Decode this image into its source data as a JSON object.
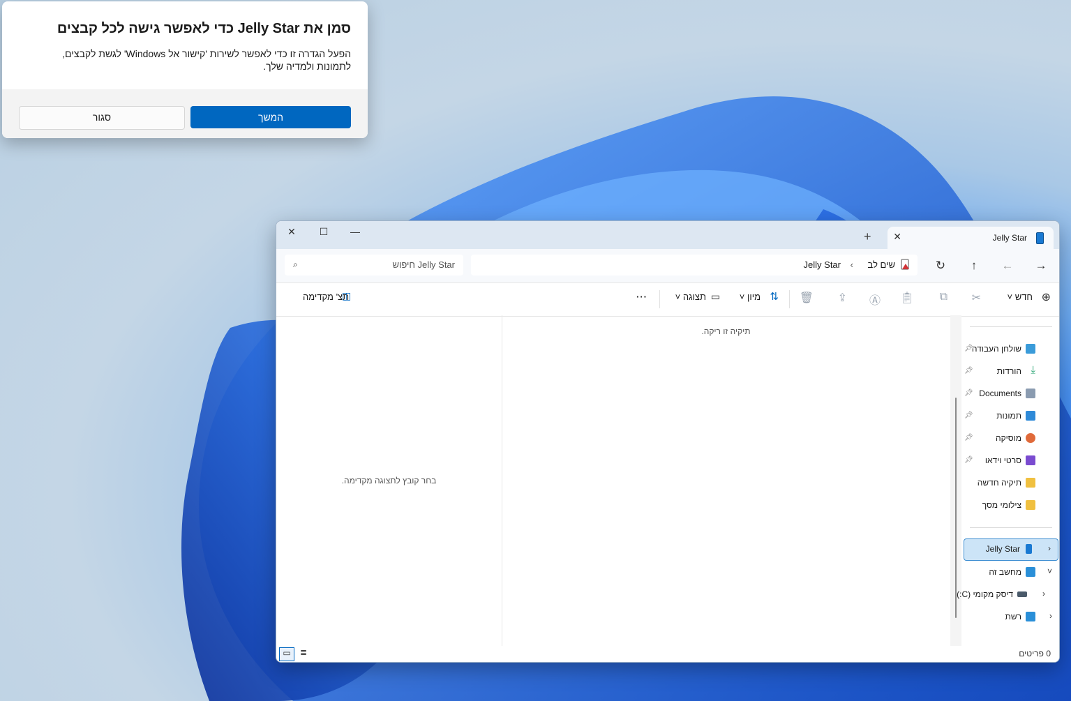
{
  "dialog": {
    "title": "סמן את Jelly Star כדי לאפשר גישה לכל קבצים",
    "body_line1": "הפעל הגדרה זו כדי לאפשר לשירות 'קישור אל Windows' לגשת לקבצים,",
    "body_line2": "לתמונות ולמדיה שלך.",
    "continue_label": "המשך",
    "close_label": "סגור"
  },
  "explorer": {
    "tab_title": "Jelly Star",
    "breadcrumb": {
      "first": "שים לב",
      "separator": "›",
      "second": "Jelly Star"
    },
    "search_placeholder": "חיפוש Jelly Star",
    "toolbar": {
      "new_label": "חדש",
      "sort_label": "מיון",
      "view_label": "תצוגה",
      "more_label": "···",
      "preview_label": "תצ' מקדימה"
    },
    "empty_folder": "תיקיה זו ריקה.",
    "preview_message": "בחר קובץ לתצוגה מקדימה.",
    "status_count": "0 פריטים",
    "nav": {
      "quick": [
        {
          "label": "שולחן העבודה",
          "icon": "desktop-icon",
          "color": "#3a9bd9"
        },
        {
          "label": "הורדות",
          "icon": "download-icon",
          "color": "#1a9e6a"
        },
        {
          "label": "Documents",
          "icon": "document-icon",
          "color": "#8a9bb0"
        },
        {
          "label": "תמונות",
          "icon": "pictures-icon",
          "color": "#2f8ad8"
        },
        {
          "label": "מוסיקה",
          "icon": "music-icon",
          "color": "#e06a3a"
        },
        {
          "label": "סרטי וידאו",
          "icon": "video-icon",
          "color": "#7a4bd0"
        },
        {
          "label": "תיקיה חדשה",
          "icon": "folder-icon",
          "color": "#f0c040"
        },
        {
          "label": "צילומי מסך",
          "icon": "folder-icon",
          "color": "#f0c040"
        }
      ],
      "tree": [
        {
          "label": "Jelly Star",
          "icon": "phone-icon",
          "color": "#1979d2"
        },
        {
          "label": "מחשב זה",
          "icon": "pc-icon",
          "color": "#2a8fd8"
        },
        {
          "label": "דיסק מקומי (C:)",
          "icon": "drive-icon",
          "color": "#4a5a6a"
        },
        {
          "label": "רשת",
          "icon": "network-icon",
          "color": "#2a8fd8"
        }
      ]
    }
  }
}
